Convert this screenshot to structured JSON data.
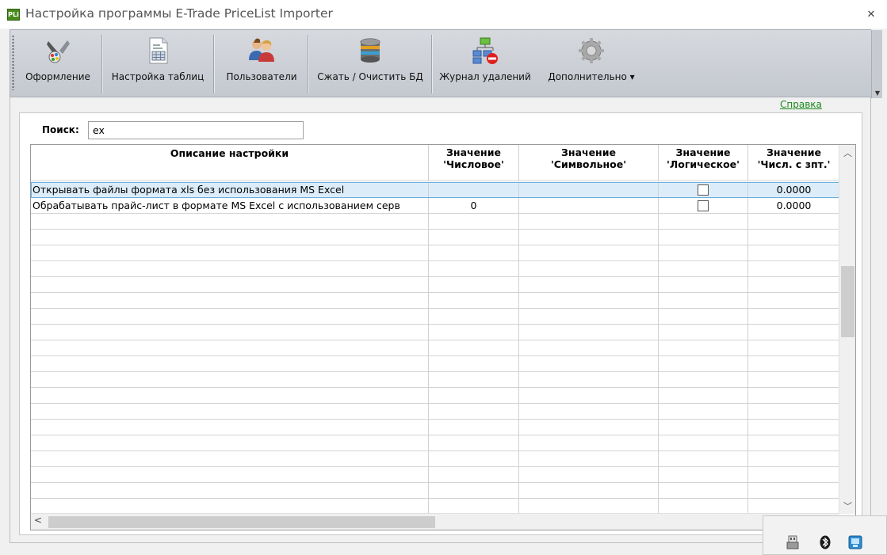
{
  "window": {
    "app_icon_text": "PLi",
    "title": "Настройка программы E-Trade PriceList Importer",
    "close_glyph": "✕"
  },
  "toolbar": {
    "items": [
      {
        "label": "Оформление",
        "icon": "design-palette-icon"
      },
      {
        "label": "Настройка таблиц",
        "icon": "table-settings-icon"
      },
      {
        "label": "Пользователи",
        "icon": "users-icon"
      },
      {
        "label": "Сжать / Очистить БД",
        "icon": "database-compact-icon"
      },
      {
        "label": "Журнал удалений",
        "icon": "deletion-log-icon"
      },
      {
        "label": "Дополнительно ▾",
        "icon": "gear-icon"
      }
    ]
  },
  "help_link": "Справка",
  "search": {
    "label": "Поиск:",
    "value": "ex"
  },
  "grid": {
    "columns": [
      "Описание настройки",
      "Значение\n'Числовое'",
      "Значение\n'Символьное'",
      "Значение\n'Логическое'",
      "Значение\n'Числ. с зпт.'"
    ],
    "rows": [
      {
        "description": "Открывать файлы формата xls без использования MS Excel",
        "numeric": "",
        "symbolic": "",
        "logical": false,
        "decimal": "0.0000",
        "selected": true
      },
      {
        "description": "Обрабатывать прайс-лист в формате MS Excel с использованием серв",
        "numeric": "0",
        "symbolic": "",
        "logical": false,
        "decimal": "0.0000",
        "selected": false
      }
    ],
    "empty_row_count": 19
  },
  "tray": {
    "icons": [
      "usb-drive-icon",
      "bluetooth-icon",
      "network-icon"
    ]
  },
  "colors": {
    "selection_bg": "#dcedf9",
    "help_link": "#1a8a1a",
    "app_icon": "#4a8a1c"
  }
}
